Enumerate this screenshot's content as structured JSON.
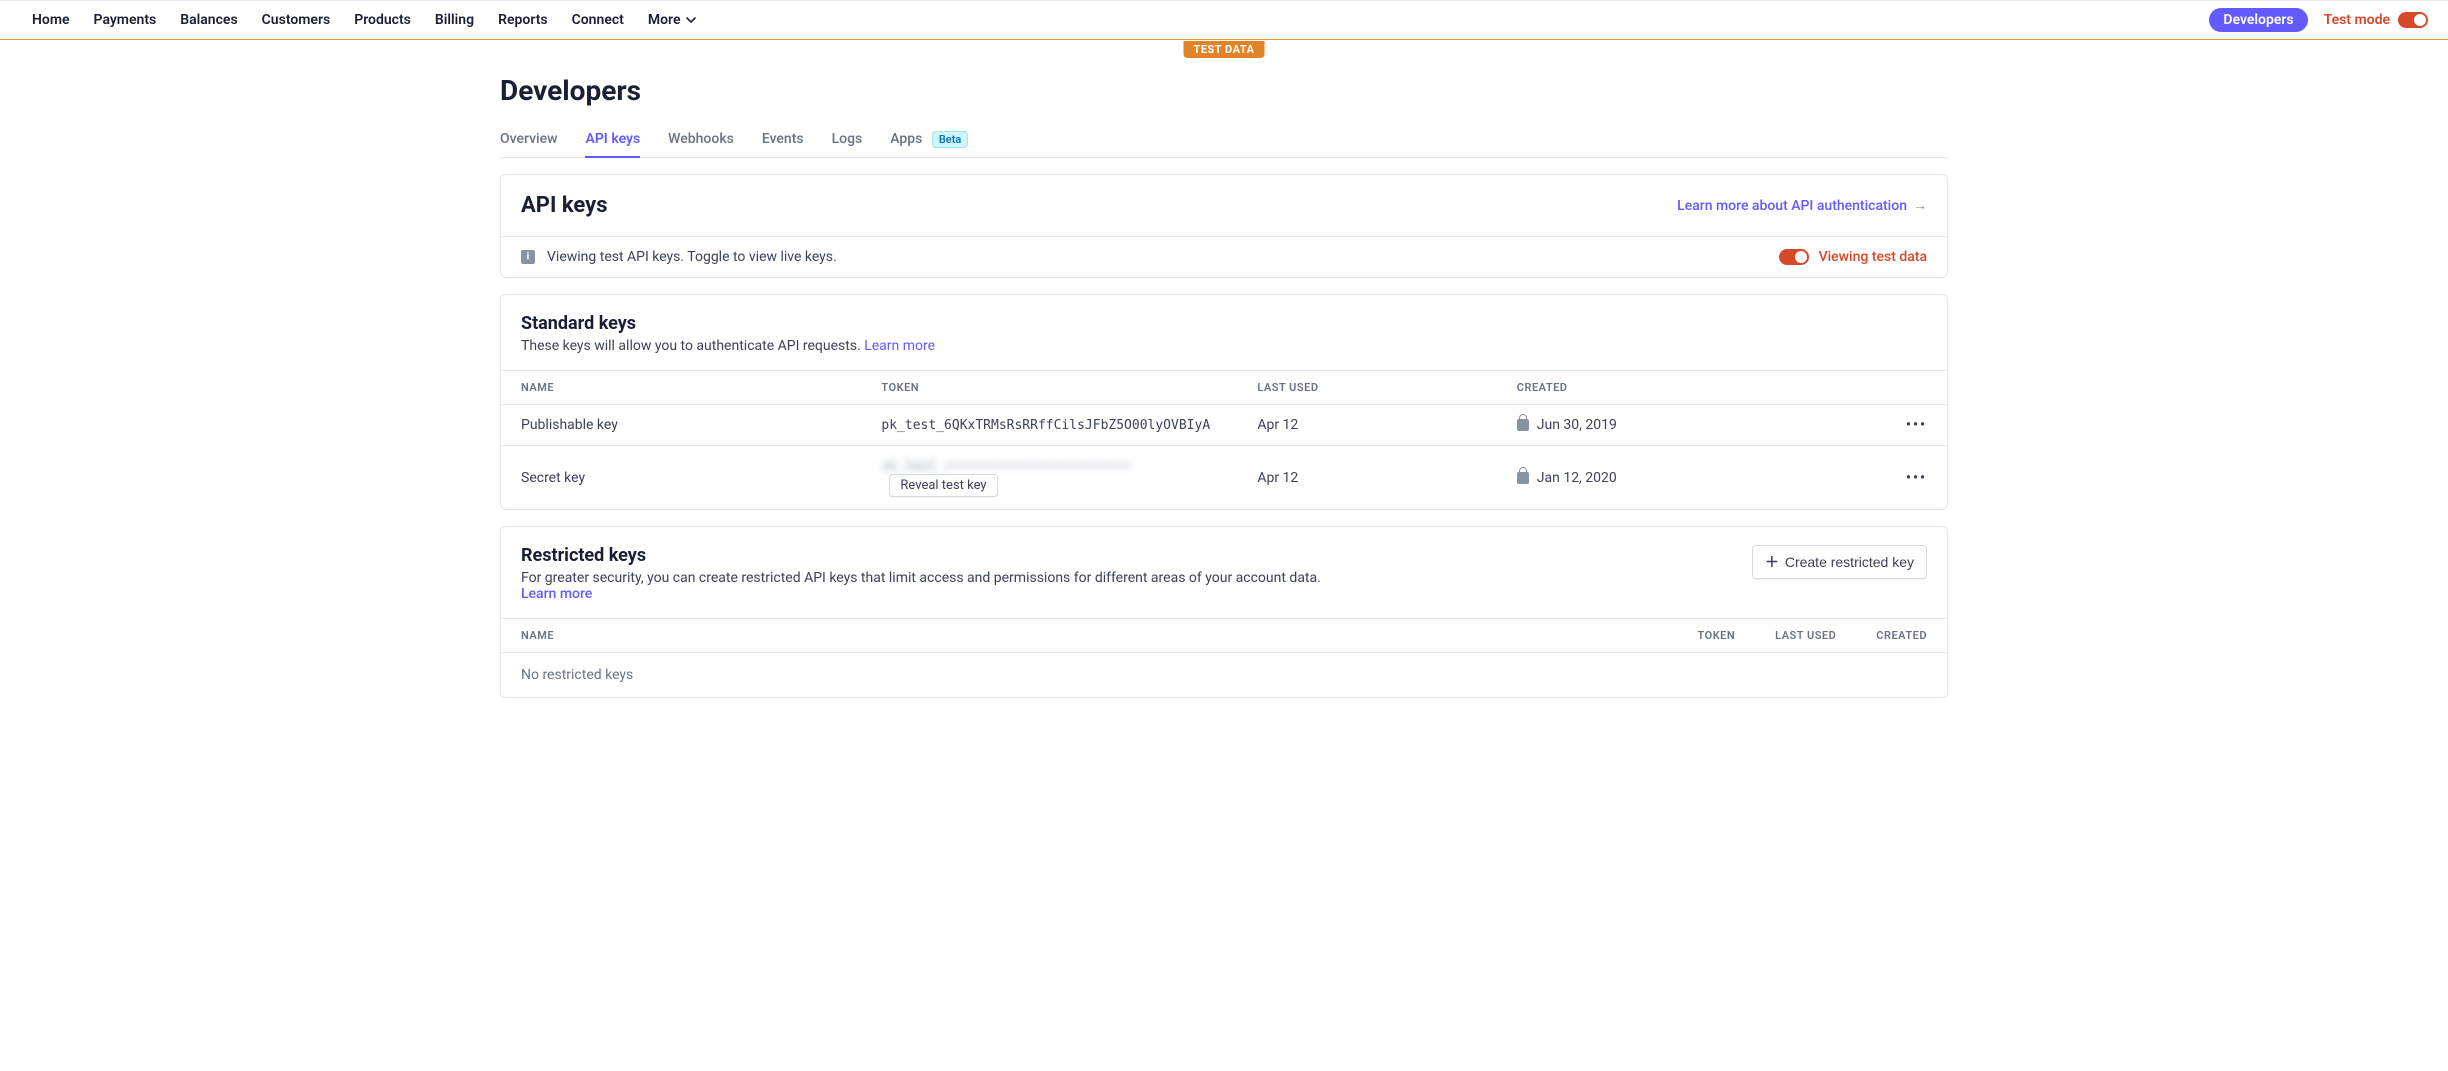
{
  "nav": {
    "items": [
      "Home",
      "Payments",
      "Balances",
      "Customers",
      "Products",
      "Billing",
      "Reports",
      "Connect"
    ],
    "more": "More",
    "developers": "Developers",
    "test_mode": "Test mode",
    "test_data_badge": "TEST DATA"
  },
  "page": {
    "title": "Developers"
  },
  "tabs": {
    "items": [
      "Overview",
      "API keys",
      "Webhooks",
      "Events",
      "Logs",
      "Apps"
    ],
    "active_index": 1,
    "beta_label": "Beta"
  },
  "api_keys_card": {
    "title": "API keys",
    "learn_more": "Learn more about API authentication",
    "info_text": "Viewing test API keys. Toggle to view live keys.",
    "viewing_label": "Viewing test data"
  },
  "standard": {
    "title": "Standard keys",
    "desc": "These keys will allow you to authenticate API requests. ",
    "learn_more": "Learn more",
    "headers": {
      "name": "NAME",
      "token": "TOKEN",
      "last_used": "LAST USED",
      "created": "CREATED"
    },
    "rows": [
      {
        "name": "Publishable key",
        "token": "pk_test_6QKxTRMsRsRRffCilsJFbZ5O00lyOVBIyA",
        "last_used": "Apr 12",
        "created": "Jun 30, 2019",
        "locked": true,
        "reveal": false
      },
      {
        "name": "Secret key",
        "token": "sk_test_••••••••••••••••••••••••",
        "last_used": "Apr 12",
        "created": "Jan 12, 2020",
        "locked": true,
        "reveal": true,
        "reveal_label": "Reveal test key"
      }
    ]
  },
  "restricted": {
    "title": "Restricted keys",
    "desc": "For greater security, you can create restricted API keys that limit access and permissions for different areas of your account data. ",
    "learn_more": "Learn more",
    "create_label": "Create restricted key",
    "headers": {
      "name": "NAME",
      "token": "TOKEN",
      "last_used": "LAST USED",
      "created": "CREATED"
    },
    "empty": "No restricted keys"
  }
}
